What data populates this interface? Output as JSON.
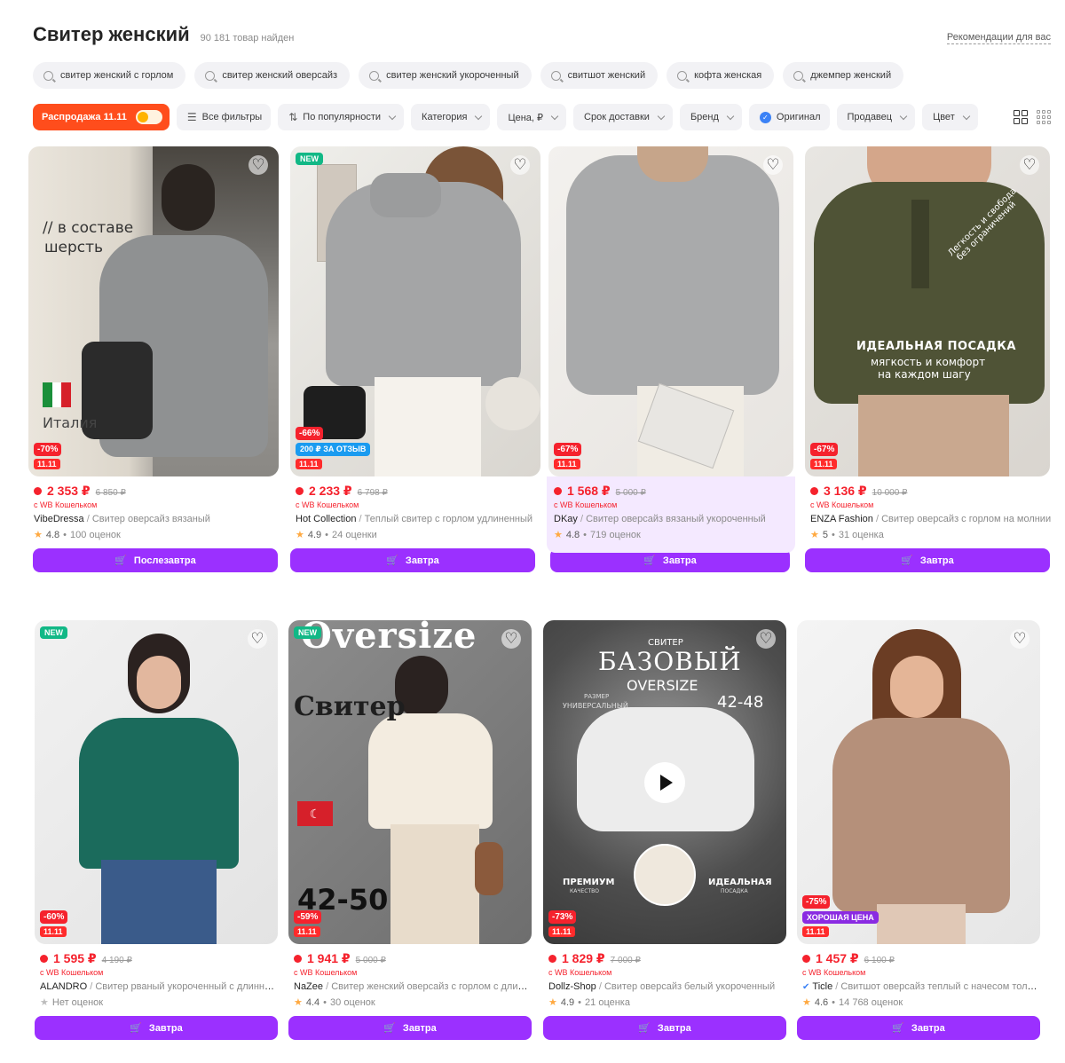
{
  "header": {
    "title": "Свитер женский",
    "count": "90 181 товар найден",
    "reco": "Рекомендации для вас"
  },
  "queries": [
    "свитер женский с горлом",
    "свитер женский оверсайз",
    "свитер женский укороченный",
    "свитшот женский",
    "кофта женская",
    "джемпер женский"
  ],
  "filters": {
    "sale": "Распродажа 11.11",
    "all": "Все фильтры",
    "sort": "По популярности",
    "category": "Категория",
    "price": "Цена, ₽",
    "delivery": "Срок доставки",
    "brand": "Бренд",
    "original": "Оригинал",
    "seller": "Продавец",
    "color": "Цвет"
  },
  "common": {
    "wallet": "с WB Кошельком",
    "promo": "11.11",
    "new": "NEW",
    "heart": "♡"
  },
  "products": [
    {
      "price": "2 353 ₽",
      "old": "6 850 ₽",
      "brand": "VibeDressa",
      "name": "Свитер оверсайз вязаный",
      "rating": "4.8",
      "reviews": "100 оценок",
      "button": "Послезавтра",
      "discount": "-70%",
      "img_text_1": "// в составе",
      "img_text_2": "шерсть",
      "img_text_3": "Италия"
    },
    {
      "price": "2 233 ₽",
      "old": "6 798 ₽",
      "brand": "Hot Collection",
      "name": "Теплый свитер с горлом удлиненный",
      "rating": "4.9",
      "reviews": "24 оценки",
      "button": "Завтра",
      "discount": "-66%",
      "bonus": "200 ₽ ЗА ОТЗЫВ"
    },
    {
      "price": "1 568 ₽",
      "old": "5 000 ₽",
      "brand": "DKay",
      "name": "Свитер оверсайз вязаный укороченный",
      "rating": "4.8",
      "reviews": "719 оценок",
      "button": "Завтра",
      "discount": "-67%"
    },
    {
      "price": "3 136 ₽",
      "old": "10 000 ₽",
      "brand": "ENZA Fashion",
      "name": "Свитер оверсайз с горлом на молнии",
      "rating": "5",
      "reviews": "31 оценка",
      "button": "Завтра",
      "discount": "-67%",
      "img_text_1": "ИДЕАЛЬНАЯ ПОСАДКА",
      "img_text_2": "мягкость и комфорт",
      "img_text_3": "на каждом шагу",
      "img_text_4": "Легкость и свобода",
      "img_text_5": "без ограничений"
    },
    {
      "price": "1 595 ₽",
      "old": "4 190 ₽",
      "brand": "ALANDRO",
      "name": "Свитер рваный укороченный с длинным рукавом",
      "rating": "",
      "reviews": "Нет оценок",
      "button": "Завтра",
      "discount": "-60%"
    },
    {
      "price": "1 941 ₽",
      "old": "5 000 ₽",
      "brand": "NaZee",
      "name": "Свитер женский оверсайз с горлом с длинным рукавом",
      "rating": "4.4",
      "reviews": "30 оценок",
      "button": "Завтра",
      "discount": "-59%",
      "img_text_1": "Oversize",
      "img_text_2": "Свитер",
      "img_text_3": "42-50"
    },
    {
      "price": "1 829 ₽",
      "old": "7 000 ₽",
      "brand": "Dollz-Shop",
      "name": "Свитер оверсайз белый укороченный",
      "rating": "4.9",
      "reviews": "21 оценка",
      "button": "Завтра",
      "discount": "-73%",
      "img_text_1": "СВИТЕР",
      "img_text_2": "БАЗОВЫЙ",
      "img_text_3": "OVERSIZE",
      "img_text_4": "42-48",
      "img_text_5": "РАЗМЕР",
      "img_text_6": "УНИВЕРСАЛЬНЫЙ",
      "img_text_7": "ПРЕМИУМ",
      "img_text_8": "КАЧЕСТВО",
      "img_text_9": "ИДЕАЛЬНАЯ",
      "img_text_10": "ПОСАДКА"
    },
    {
      "price": "1 457 ₽",
      "old": "6 100 ₽",
      "brand": "Ticle",
      "name": "Свитшот оверсайз теплый с начесом толстовка",
      "rating": "4.6",
      "reviews": "14 768 оценок",
      "button": "Завтра",
      "discount": "-75%",
      "good": "ХОРОШАЯ ЦЕНА"
    }
  ]
}
